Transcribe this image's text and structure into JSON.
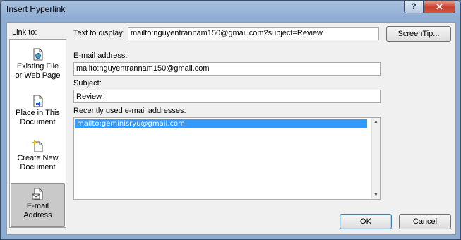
{
  "window": {
    "title": "Insert Hyperlink",
    "help_glyph": "?",
    "close_glyph": "✕"
  },
  "link_to": {
    "label": "Link to:",
    "items": [
      {
        "line1": "Existing File",
        "line2": "or Web Page",
        "icon": "globe-page-icon"
      },
      {
        "line1": "Place in This",
        "line2": "Document",
        "icon": "document-place-icon"
      },
      {
        "line1": "Create New",
        "line2": "Document",
        "icon": "new-document-icon"
      },
      {
        "line1": "E-mail",
        "line2": "Address",
        "icon": "email-address-icon",
        "selected": true
      }
    ]
  },
  "text_to_display": {
    "label": "Text to display:",
    "value": "mailto:nguyentrannam150@gmail.com?subject=Review"
  },
  "screentip_button": "ScreenTip...",
  "email_address": {
    "label": "E-mail address:",
    "value": "mailto:nguyentrannam150@gmail.com"
  },
  "subject": {
    "label": "Subject:",
    "value": "Review"
  },
  "recent": {
    "label": "Recently used e-mail addresses:",
    "items": [
      "mailto:geminisryu@gmail.com"
    ]
  },
  "buttons": {
    "ok": "OK",
    "cancel": "Cancel"
  },
  "colors": {
    "selection": "#3399ff",
    "title_gradient": "#a9c1de",
    "close_button": "#c7412c"
  }
}
